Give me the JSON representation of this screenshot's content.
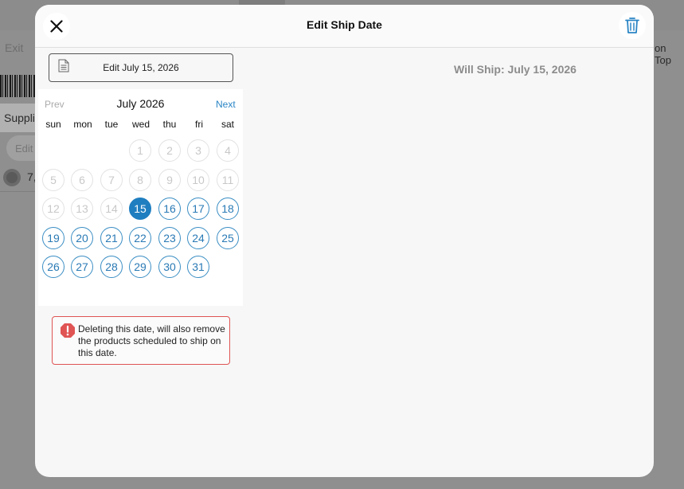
{
  "background": {
    "exit_label": "Exit",
    "on_top_label": "on Top",
    "supplier_label": "Suppli",
    "edit_label": "Edit",
    "row_value": "7,"
  },
  "modal": {
    "title": "Edit Ship Date",
    "close_icon": "close-icon",
    "trash_icon": "trash-icon",
    "edit_field_text": "Edit July 15, 2026",
    "will_ship_text": "Will Ship: July 15, 2026",
    "accent_color": "#1f7ec0",
    "warning_color": "#e05454"
  },
  "calendar": {
    "prev_label": "Prev",
    "next_label": "Next",
    "month_title": "July 2026",
    "weekdays": [
      "sun",
      "mon",
      "tue",
      "wed",
      "thu",
      "fri",
      "sat"
    ],
    "first_weekday_index": 3,
    "days_in_month": 31,
    "selected_day": 15,
    "disabled_through": 14,
    "days": [
      "1",
      "2",
      "3",
      "4",
      "5",
      "6",
      "7",
      "8",
      "9",
      "10",
      "11",
      "12",
      "13",
      "14",
      "15",
      "16",
      "17",
      "18",
      "19",
      "20",
      "21",
      "22",
      "23",
      "24",
      "25",
      "26",
      "27",
      "28",
      "29",
      "30",
      "31"
    ]
  },
  "warning": {
    "text": "Deleting this date, will also remove the products scheduled to ship on this date."
  }
}
